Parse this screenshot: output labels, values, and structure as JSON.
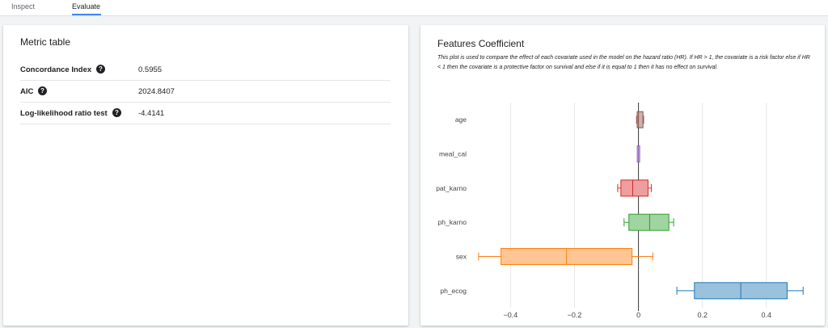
{
  "tabs": [
    {
      "label": "Inspect",
      "active": false
    },
    {
      "label": "Evaluate",
      "active": true
    }
  ],
  "metrics": {
    "title": "Metric table",
    "rows": [
      {
        "label": "Concordance Index",
        "value": "0.5955"
      },
      {
        "label": "AIC",
        "value": "2024.8407"
      },
      {
        "label": "Log-likelihood ratio test",
        "value": "-4.4141"
      }
    ]
  },
  "features": {
    "title": "Features Coefficient",
    "description": "This plot is used to compare the effect of each covariate used in the model on the hazard ratio (HR). If HR > 1, the covariate is a risk factor else if HR < 1 then the covariate is a protective factor on survival and else if it is equal to 1 then it has no effect on survival."
  },
  "chart_data": {
    "type": "box",
    "orientation": "horizontal",
    "categories": [
      "age",
      "meal_cal",
      "pat_karno",
      "ph_karno",
      "sex",
      "ph_ecog"
    ],
    "series": [
      {
        "name": "age",
        "whisker_low": -0.006,
        "q1": -0.004,
        "median": 0.0,
        "q3": 0.014,
        "whisker_high": 0.016,
        "color": "#8c564b"
      },
      {
        "name": "meal_cal",
        "whisker_low": -0.001,
        "q1": -0.001,
        "median": 0.0,
        "q3": 0.001,
        "whisker_high": 0.001,
        "color": "#9467bd"
      },
      {
        "name": "pat_karno",
        "whisker_low": -0.065,
        "q1": -0.055,
        "median": -0.018,
        "q3": 0.03,
        "whisker_high": 0.04,
        "color": "#d62728"
      },
      {
        "name": "ph_karno",
        "whisker_low": -0.045,
        "q1": -0.03,
        "median": 0.035,
        "q3": 0.095,
        "whisker_high": 0.11,
        "color": "#2ca02c"
      },
      {
        "name": "sex",
        "whisker_low": -0.5,
        "q1": -0.43,
        "median": -0.225,
        "q3": -0.02,
        "whisker_high": 0.045,
        "color": "#ff7f0e"
      },
      {
        "name": "ph_ecog",
        "whisker_low": 0.12,
        "q1": 0.175,
        "median": 0.32,
        "q3": 0.465,
        "whisker_high": 0.515,
        "color": "#1f77b4"
      }
    ],
    "xticks": [
      "−0.4",
      "−0.2",
      "0",
      "0.2",
      "0.4"
    ],
    "xtick_values": [
      -0.4,
      -0.2,
      0,
      0.2,
      0.4
    ],
    "xlim": [
      -0.52,
      0.57
    ],
    "grid": true
  }
}
